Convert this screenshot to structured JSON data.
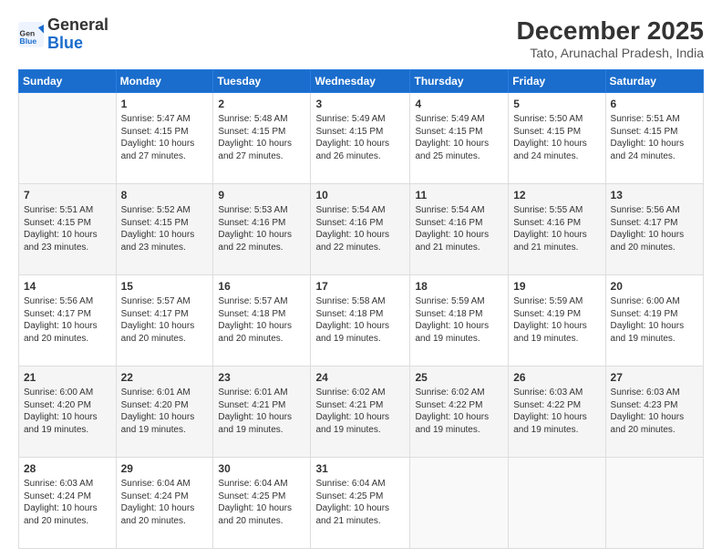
{
  "logo": {
    "general": "General",
    "blue": "Blue"
  },
  "title": "December 2025",
  "subtitle": "Tato, Arunachal Pradesh, India",
  "weekdays": [
    "Sunday",
    "Monday",
    "Tuesday",
    "Wednesday",
    "Thursday",
    "Friday",
    "Saturday"
  ],
  "weeks": [
    [
      {
        "day": "",
        "info": ""
      },
      {
        "day": "1",
        "info": "Sunrise: 5:47 AM\nSunset: 4:15 PM\nDaylight: 10 hours\nand 27 minutes."
      },
      {
        "day": "2",
        "info": "Sunrise: 5:48 AM\nSunset: 4:15 PM\nDaylight: 10 hours\nand 27 minutes."
      },
      {
        "day": "3",
        "info": "Sunrise: 5:49 AM\nSunset: 4:15 PM\nDaylight: 10 hours\nand 26 minutes."
      },
      {
        "day": "4",
        "info": "Sunrise: 5:49 AM\nSunset: 4:15 PM\nDaylight: 10 hours\nand 25 minutes."
      },
      {
        "day": "5",
        "info": "Sunrise: 5:50 AM\nSunset: 4:15 PM\nDaylight: 10 hours\nand 24 minutes."
      },
      {
        "day": "6",
        "info": "Sunrise: 5:51 AM\nSunset: 4:15 PM\nDaylight: 10 hours\nand 24 minutes."
      }
    ],
    [
      {
        "day": "7",
        "info": "Sunrise: 5:51 AM\nSunset: 4:15 PM\nDaylight: 10 hours\nand 23 minutes."
      },
      {
        "day": "8",
        "info": "Sunrise: 5:52 AM\nSunset: 4:15 PM\nDaylight: 10 hours\nand 23 minutes."
      },
      {
        "day": "9",
        "info": "Sunrise: 5:53 AM\nSunset: 4:16 PM\nDaylight: 10 hours\nand 22 minutes."
      },
      {
        "day": "10",
        "info": "Sunrise: 5:54 AM\nSunset: 4:16 PM\nDaylight: 10 hours\nand 22 minutes."
      },
      {
        "day": "11",
        "info": "Sunrise: 5:54 AM\nSunset: 4:16 PM\nDaylight: 10 hours\nand 21 minutes."
      },
      {
        "day": "12",
        "info": "Sunrise: 5:55 AM\nSunset: 4:16 PM\nDaylight: 10 hours\nand 21 minutes."
      },
      {
        "day": "13",
        "info": "Sunrise: 5:56 AM\nSunset: 4:17 PM\nDaylight: 10 hours\nand 20 minutes."
      }
    ],
    [
      {
        "day": "14",
        "info": "Sunrise: 5:56 AM\nSunset: 4:17 PM\nDaylight: 10 hours\nand 20 minutes."
      },
      {
        "day": "15",
        "info": "Sunrise: 5:57 AM\nSunset: 4:17 PM\nDaylight: 10 hours\nand 20 minutes."
      },
      {
        "day": "16",
        "info": "Sunrise: 5:57 AM\nSunset: 4:18 PM\nDaylight: 10 hours\nand 20 minutes."
      },
      {
        "day": "17",
        "info": "Sunrise: 5:58 AM\nSunset: 4:18 PM\nDaylight: 10 hours\nand 19 minutes."
      },
      {
        "day": "18",
        "info": "Sunrise: 5:59 AM\nSunset: 4:18 PM\nDaylight: 10 hours\nand 19 minutes."
      },
      {
        "day": "19",
        "info": "Sunrise: 5:59 AM\nSunset: 4:19 PM\nDaylight: 10 hours\nand 19 minutes."
      },
      {
        "day": "20",
        "info": "Sunrise: 6:00 AM\nSunset: 4:19 PM\nDaylight: 10 hours\nand 19 minutes."
      }
    ],
    [
      {
        "day": "21",
        "info": "Sunrise: 6:00 AM\nSunset: 4:20 PM\nDaylight: 10 hours\nand 19 minutes."
      },
      {
        "day": "22",
        "info": "Sunrise: 6:01 AM\nSunset: 4:20 PM\nDaylight: 10 hours\nand 19 minutes."
      },
      {
        "day": "23",
        "info": "Sunrise: 6:01 AM\nSunset: 4:21 PM\nDaylight: 10 hours\nand 19 minutes."
      },
      {
        "day": "24",
        "info": "Sunrise: 6:02 AM\nSunset: 4:21 PM\nDaylight: 10 hours\nand 19 minutes."
      },
      {
        "day": "25",
        "info": "Sunrise: 6:02 AM\nSunset: 4:22 PM\nDaylight: 10 hours\nand 19 minutes."
      },
      {
        "day": "26",
        "info": "Sunrise: 6:03 AM\nSunset: 4:22 PM\nDaylight: 10 hours\nand 19 minutes."
      },
      {
        "day": "27",
        "info": "Sunrise: 6:03 AM\nSunset: 4:23 PM\nDaylight: 10 hours\nand 20 minutes."
      }
    ],
    [
      {
        "day": "28",
        "info": "Sunrise: 6:03 AM\nSunset: 4:24 PM\nDaylight: 10 hours\nand 20 minutes."
      },
      {
        "day": "29",
        "info": "Sunrise: 6:04 AM\nSunset: 4:24 PM\nDaylight: 10 hours\nand 20 minutes."
      },
      {
        "day": "30",
        "info": "Sunrise: 6:04 AM\nSunset: 4:25 PM\nDaylight: 10 hours\nand 20 minutes."
      },
      {
        "day": "31",
        "info": "Sunrise: 6:04 AM\nSunset: 4:25 PM\nDaylight: 10 hours\nand 21 minutes."
      },
      {
        "day": "",
        "info": ""
      },
      {
        "day": "",
        "info": ""
      },
      {
        "day": "",
        "info": ""
      }
    ]
  ]
}
